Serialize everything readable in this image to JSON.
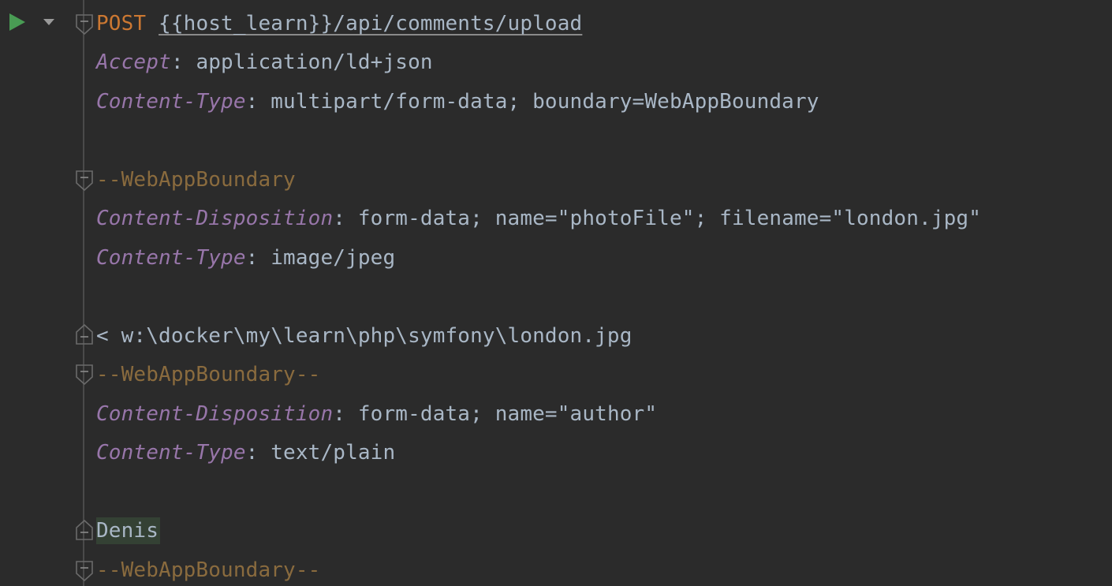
{
  "request": {
    "method": "POST",
    "url": "{{host_learn}}/api/comments/upload",
    "headers": [
      {
        "name": "Accept",
        "value": "application/ld+json"
      },
      {
        "name": "Content-Type",
        "value": "multipart/form-data; boundary=WebAppBoundary"
      }
    ]
  },
  "parts": {
    "boundary1": "--WebAppBoundary",
    "part1_headers": [
      {
        "name": "Content-Disposition",
        "value": "form-data; name=\"photoFile\"; filename=\"london.jpg\""
      },
      {
        "name": "Content-Type",
        "value": "image/jpeg"
      }
    ],
    "file_ref": "< w:\\docker\\my\\learn\\php\\symfony\\london.jpg",
    "boundary2": "--WebAppBoundary--",
    "part2_headers": [
      {
        "name": "Content-Disposition",
        "value": "form-data; name=\"author\""
      },
      {
        "name": "Content-Type",
        "value": "text/plain"
      }
    ],
    "body_value": "Denis",
    "boundary3": "--WebAppBoundary--"
  },
  "colors": {
    "background": "#2b2b2b",
    "method": "#cc7832",
    "header_name": "#9876aa",
    "text": "#a9b7c6",
    "boundary": "#8a6b3e",
    "run": "#499c54",
    "highlight": "#344134"
  },
  "icons": {
    "run": "run-icon",
    "dropdown": "chevron-down-icon",
    "fold": "fold-icon"
  }
}
